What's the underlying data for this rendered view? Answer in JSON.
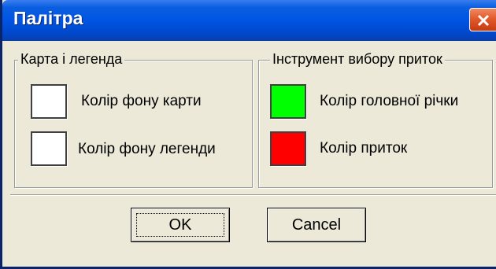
{
  "window": {
    "title": "Палітра"
  },
  "groups": {
    "map_legend": {
      "label": "Карта і легенда",
      "rows": [
        {
          "label": "Колір фону карти",
          "color": "#ffffff"
        },
        {
          "label": "Колір фону легенди",
          "color": "#ffffff"
        }
      ]
    },
    "tributary_tool": {
      "label": "Інструмент вибору приток",
      "rows": [
        {
          "label": "Колір головної річки",
          "color": "#00ff00"
        },
        {
          "label": "Колір приток",
          "color": "#ff0000"
        }
      ]
    }
  },
  "buttons": {
    "ok_label": "OK",
    "cancel_label": "Cancel"
  },
  "colors": {
    "title_bar": "#0054e3",
    "close_button": "#e25a2c",
    "dialog_background": "#ece9d8"
  }
}
